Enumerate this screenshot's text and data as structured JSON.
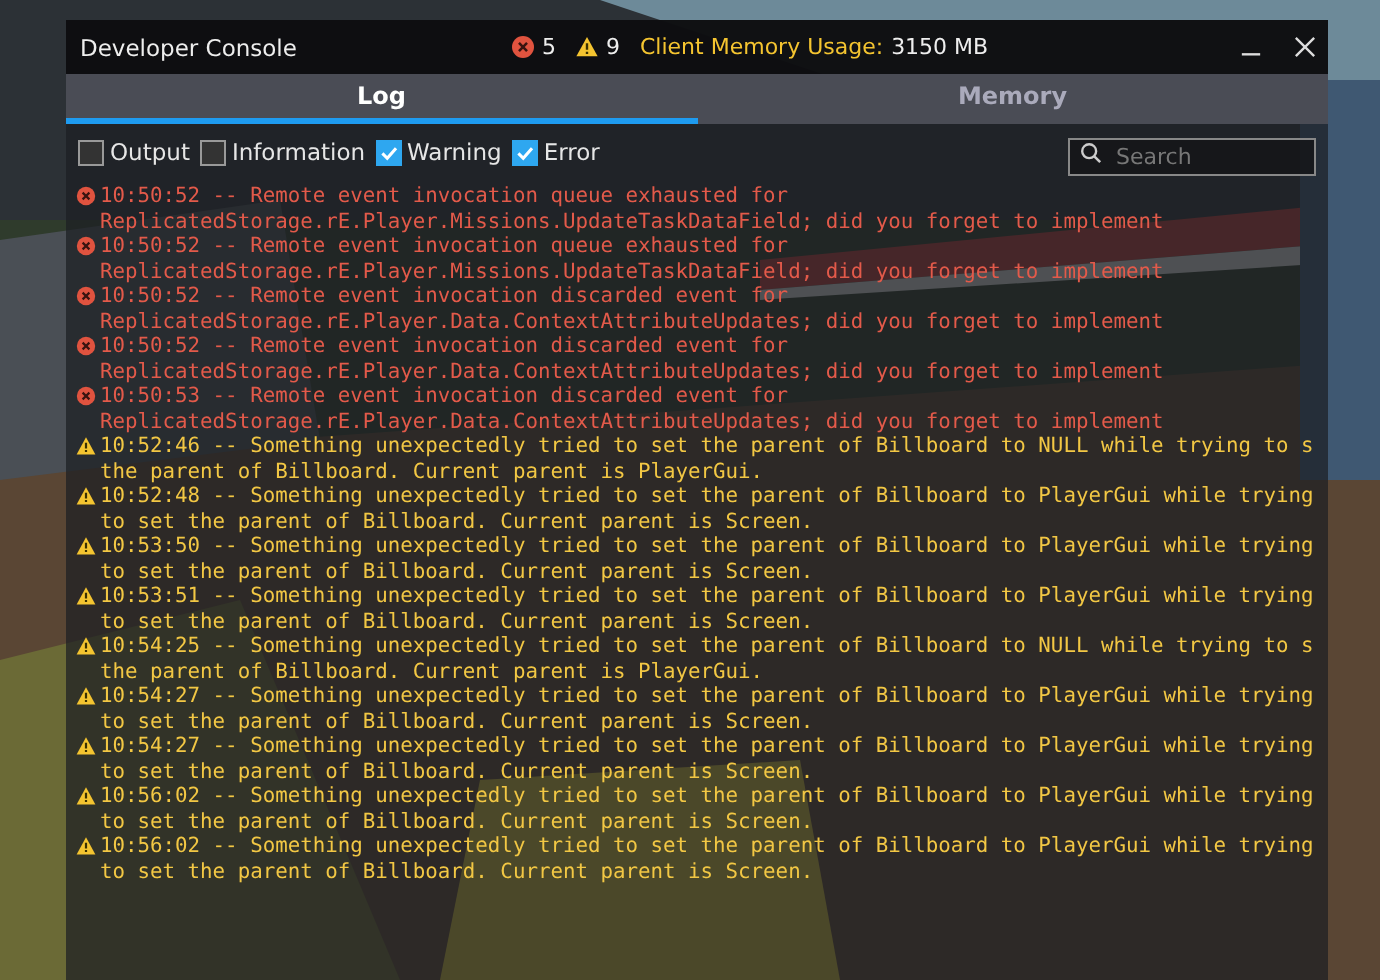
{
  "window": {
    "title": "Developer Console",
    "error_count": "5",
    "warning_count": "9",
    "memory_label": "Client Memory Usage:",
    "memory_value": "3150 MB"
  },
  "tabs": [
    {
      "label": "Log",
      "selected": true
    },
    {
      "label": "Memory",
      "selected": false
    }
  ],
  "filters": [
    {
      "label": "Output",
      "checked": false
    },
    {
      "label": "Information",
      "checked": false
    },
    {
      "label": "Warning",
      "checked": true
    },
    {
      "label": "Error",
      "checked": true
    }
  ],
  "search": {
    "placeholder": "Search"
  },
  "log": [
    {
      "kind": "error",
      "lines": [
        "10:50:52 -- Remote event invocation queue exhausted for",
        "ReplicatedStorage.rE.Player.Missions.UpdateTaskDataField; did you forget to implement"
      ]
    },
    {
      "kind": "error",
      "lines": [
        "10:50:52 -- Remote event invocation queue exhausted for",
        "ReplicatedStorage.rE.Player.Missions.UpdateTaskDataField; did you forget to implement"
      ]
    },
    {
      "kind": "error",
      "lines": [
        "10:50:52 -- Remote event invocation discarded event for",
        "ReplicatedStorage.rE.Player.Data.ContextAttributeUpdates; did you forget to implement"
      ]
    },
    {
      "kind": "error",
      "lines": [
        "10:50:52 -- Remote event invocation discarded event for",
        "ReplicatedStorage.rE.Player.Data.ContextAttributeUpdates; did you forget to implement"
      ]
    },
    {
      "kind": "error",
      "lines": [
        "10:50:53 -- Remote event invocation discarded event for",
        "ReplicatedStorage.rE.Player.Data.ContextAttributeUpdates; did you forget to implement"
      ]
    },
    {
      "kind": "warning",
      "lines": [
        "10:52:46 -- Something unexpectedly tried to set the parent of Billboard to NULL while trying to s",
        "the parent of Billboard. Current parent is PlayerGui."
      ]
    },
    {
      "kind": "warning",
      "lines": [
        "10:52:48 -- Something unexpectedly tried to set the parent of Billboard to PlayerGui while trying",
        "to set the parent of Billboard. Current parent is Screen."
      ]
    },
    {
      "kind": "warning",
      "lines": [
        "10:53:50 -- Something unexpectedly tried to set the parent of Billboard to PlayerGui while trying",
        "to set the parent of Billboard. Current parent is Screen."
      ]
    },
    {
      "kind": "warning",
      "lines": [
        "10:53:51 -- Something unexpectedly tried to set the parent of Billboard to PlayerGui while trying",
        "to set the parent of Billboard. Current parent is Screen."
      ]
    },
    {
      "kind": "warning",
      "lines": [
        "10:54:25 -- Something unexpectedly tried to set the parent of Billboard to NULL while trying to s",
        "the parent of Billboard. Current parent is PlayerGui."
      ]
    },
    {
      "kind": "warning",
      "lines": [
        "10:54:27 -- Something unexpectedly tried to set the parent of Billboard to PlayerGui while trying",
        "to set the parent of Billboard. Current parent is Screen."
      ]
    },
    {
      "kind": "warning",
      "lines": [
        "10:54:27 -- Something unexpectedly tried to set the parent of Billboard to PlayerGui while trying",
        "to set the parent of Billboard. Current parent is Screen."
      ]
    },
    {
      "kind": "warning",
      "lines": [
        "10:56:02 -- Something unexpectedly tried to set the parent of Billboard to PlayerGui while trying",
        "to set the parent of Billboard. Current parent is Screen."
      ]
    },
    {
      "kind": "warning",
      "lines": [
        "10:56:02 -- Something unexpectedly tried to set the parent of Billboard to PlayerGui while trying",
        "to set the parent of Billboard. Current parent is Screen."
      ]
    }
  ]
}
